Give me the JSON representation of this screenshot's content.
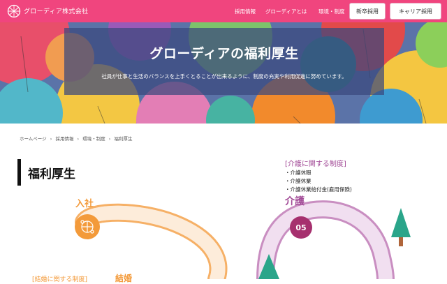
{
  "header": {
    "brand": "グローディア株式会社",
    "nav": [
      "採用情報",
      "グローディアとは",
      "環境・制度"
    ],
    "btn_new": "新卒採用",
    "btn_career": "キャリア採用"
  },
  "hero": {
    "title": "グローディアの福利厚生",
    "subtitle": "社員が仕事と生活のバランスを上手くとることが出来るように、制度の充実や利用促進に努めています。"
  },
  "breadcrumb": [
    "ホームページ",
    "›",
    "採用情報",
    "›",
    "環境・制度",
    "›",
    "福利厚生"
  ],
  "section": {
    "title": "福利厚生",
    "care": {
      "heading": "[介護に関する制度]",
      "items": [
        "・介護休暇",
        "・介護休業",
        "・介護休業給付金(雇用保険)"
      ],
      "label": "介護",
      "step": "05"
    },
    "join_label": "入社",
    "marriage_label": "結婚",
    "marriage_heading": "[結婚に関する制度]"
  },
  "colors": {
    "header": "#f0457e",
    "orange": "#f39a3a",
    "purple": "#a24b97",
    "tree": "#2aa58a"
  }
}
